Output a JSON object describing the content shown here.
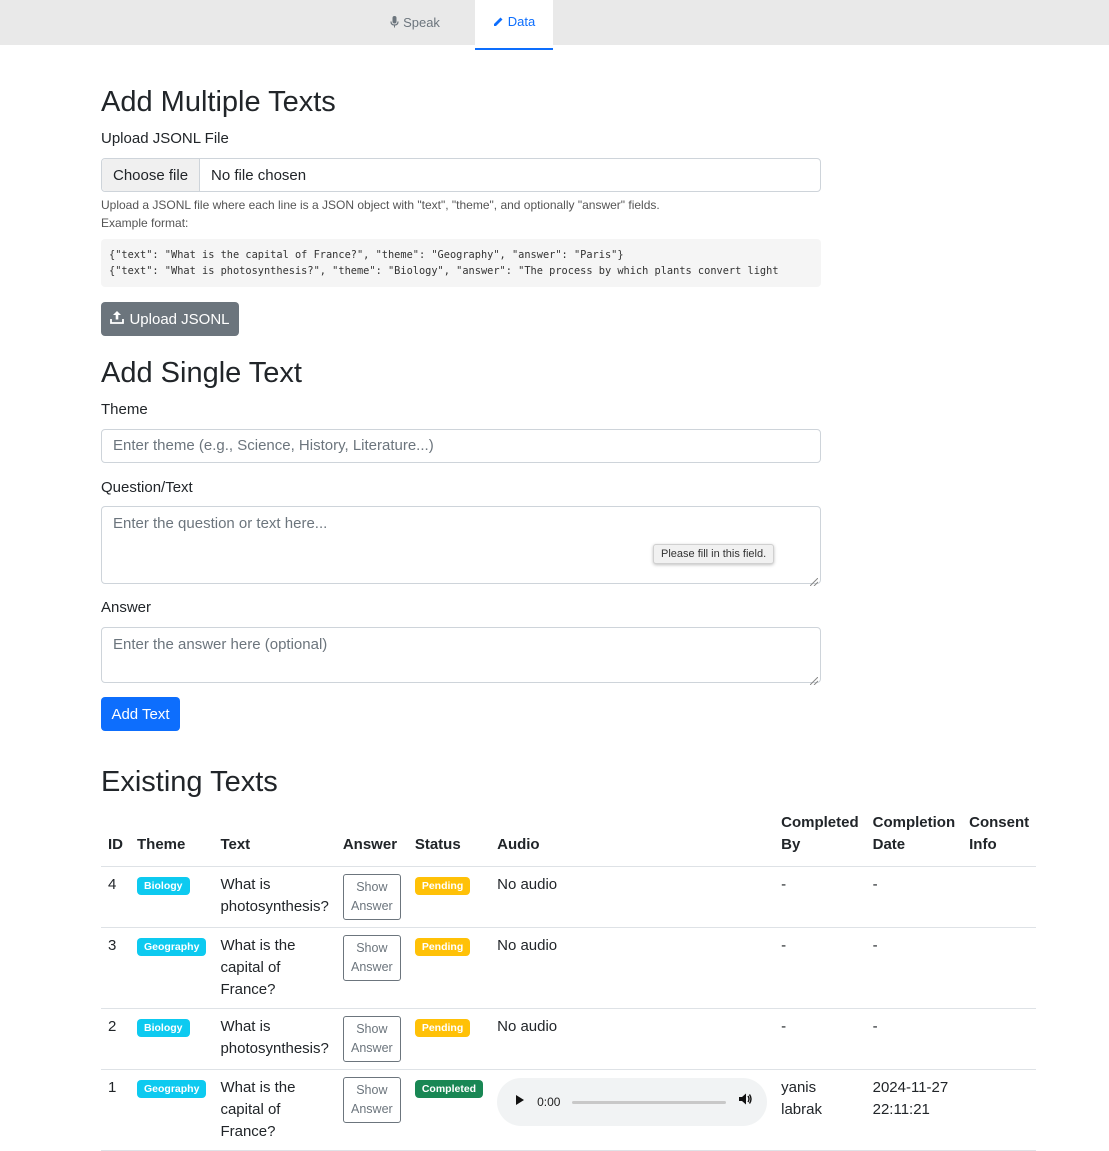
{
  "nav": {
    "tabs": [
      {
        "label": "Speak",
        "icon": "microphone-icon"
      },
      {
        "label": "Data",
        "icon": "pencil-icon"
      }
    ],
    "active": "Data"
  },
  "multi": {
    "title": "Add Multiple Texts",
    "upload_label": "Upload JSONL File",
    "choose_file": "Choose file",
    "file_status": "No file chosen",
    "help_line1": "Upload a JSONL file where each line is a JSON object with \"text\", \"theme\", and optionally \"answer\" fields.",
    "help_line2": "Example format:",
    "example_line1": "{\"text\": \"What is the capital of France?\", \"theme\": \"Geography\", \"answer\": \"Paris\"}",
    "example_line2": "{\"text\": \"What is photosynthesis?\", \"theme\": \"Biology\", \"answer\": \"The process by which plants convert light",
    "upload_button": "Upload JSONL"
  },
  "single": {
    "title": "Add Single Text",
    "theme_label": "Theme",
    "theme_placeholder": "Enter theme (e.g., Science, History, Literature...)",
    "question_label": "Question/Text",
    "question_placeholder": "Enter the question or text here...",
    "validation_tooltip": "Please fill in this field.",
    "answer_label": "Answer",
    "answer_placeholder": "Enter the answer here (optional)",
    "add_button": "Add Text"
  },
  "existing": {
    "title": "Existing Texts",
    "headers": {
      "id": "ID",
      "theme": "Theme",
      "text": "Text",
      "answer": "Answer",
      "status": "Status",
      "audio": "Audio",
      "completed_by": "Completed By",
      "completion_date": "Completion Date",
      "consent": "Consent Info"
    },
    "show_answer": "Show Answer",
    "rows": [
      {
        "id": "4",
        "theme": "Biology",
        "text": "What is photosynthesis?",
        "status": "Pending",
        "audio": "No audio",
        "completed_by": "-",
        "completion_date": "-",
        "consent": ""
      },
      {
        "id": "3",
        "theme": "Geography",
        "text": "What is the capital of France?",
        "status": "Pending",
        "audio": "No audio",
        "completed_by": "-",
        "completion_date": "-",
        "consent": ""
      },
      {
        "id": "2",
        "theme": "Biology",
        "text": "What is photosynthesis?",
        "status": "Pending",
        "audio": "No audio",
        "completed_by": "-",
        "completion_date": "-",
        "consent": ""
      },
      {
        "id": "1",
        "theme": "Geography",
        "text": "What is the capital of France?",
        "status": "Completed",
        "audio_time": "0:00",
        "completed_by": "yanis labrak",
        "completion_date": "2024-11-27 22:11:21",
        "consent": ""
      }
    ]
  },
  "colors": {
    "primary": "#0d6efd",
    "secondary": "#6c757d",
    "info": "#0dcaf0",
    "warning": "#ffc107",
    "success": "#198754"
  }
}
